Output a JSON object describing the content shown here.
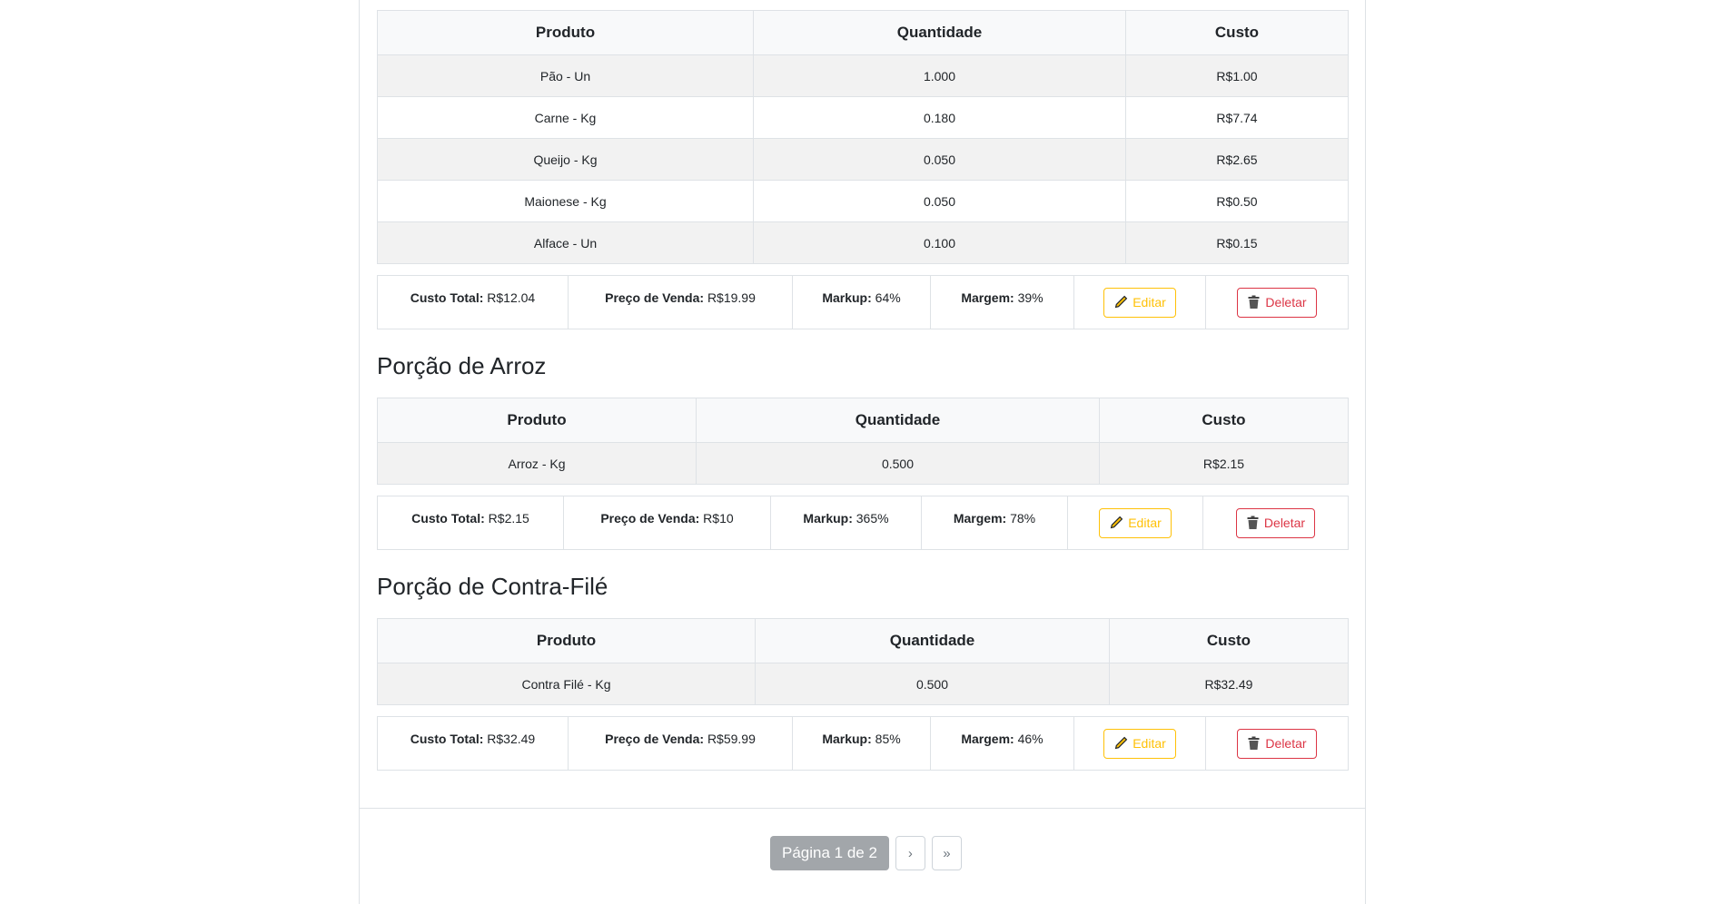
{
  "recipes": [
    {
      "title": "",
      "headers": [
        "Produto",
        "Quantidade",
        "Custo"
      ],
      "rows": [
        [
          "Pão - Un",
          "1.000",
          "R$1.00"
        ],
        [
          "Carne - Kg",
          "0.180",
          "R$7.74"
        ],
        [
          "Queijo - Kg",
          "0.050",
          "R$2.65"
        ],
        [
          "Maionese - Kg",
          "0.050",
          "R$0.50"
        ],
        [
          "Alface - Un",
          "0.100",
          "R$0.15"
        ]
      ],
      "summary": {
        "custo_total_label": "Custo Total:",
        "custo_total": "R$12.04",
        "preco_label": "Preço de Venda:",
        "preco": "R$19.99",
        "markup_label": "Markup:",
        "markup": "64%",
        "margem_label": "Margem:",
        "margem": "39%",
        "edit": "Editar",
        "delete": "Deletar"
      }
    },
    {
      "title": "Porção de Arroz",
      "headers": [
        "Produto",
        "Quantidade",
        "Custo"
      ],
      "rows": [
        [
          "Arroz - Kg",
          "0.500",
          "R$2.15"
        ]
      ],
      "summary": {
        "custo_total_label": "Custo Total:",
        "custo_total": "R$2.15",
        "preco_label": "Preço de Venda:",
        "preco": "R$10",
        "markup_label": "Markup:",
        "markup": "365%",
        "margem_label": "Margem:",
        "margem": "78%",
        "edit": "Editar",
        "delete": "Deletar"
      }
    },
    {
      "title": "Porção de Contra-Filé",
      "headers": [
        "Produto",
        "Quantidade",
        "Custo"
      ],
      "rows": [
        [
          "Contra Filé - Kg",
          "0.500",
          "R$32.49"
        ]
      ],
      "summary": {
        "custo_total_label": "Custo Total:",
        "custo_total": "R$32.49",
        "preco_label": "Preço de Venda:",
        "preco": "R$59.99",
        "markup_label": "Markup:",
        "markup": "85%",
        "margem_label": "Margem:",
        "margem": "46%",
        "edit": "Editar",
        "delete": "Deletar"
      }
    }
  ],
  "pagination": {
    "current": "Página 1 de 2",
    "next": "›",
    "last": "»"
  },
  "colors": {
    "edit": "#ffc107",
    "delete": "#dc3545",
    "current_page": "#a2a6aa"
  }
}
